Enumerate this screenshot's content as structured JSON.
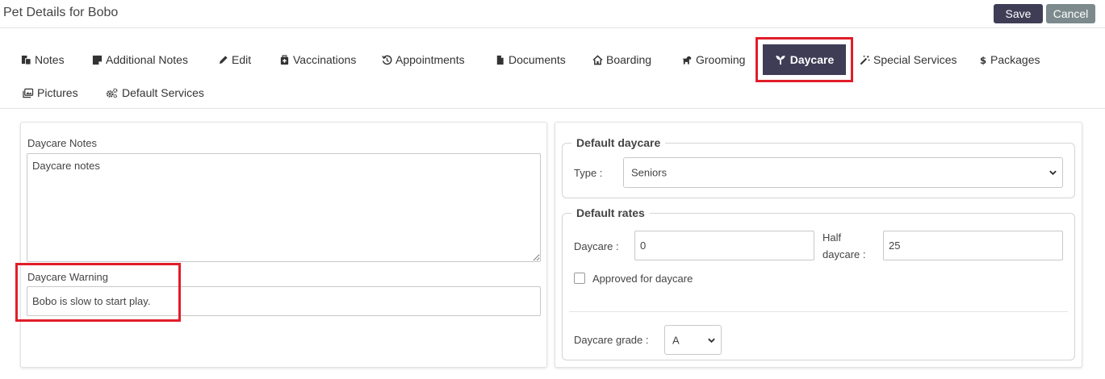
{
  "header": {
    "title": "Pet Details for Bobo",
    "save_label": "Save",
    "cancel_label": "Cancel"
  },
  "tabs": [
    {
      "label": "Notes",
      "icon": "notes-icon"
    },
    {
      "label": "Additional Notes",
      "icon": "sticky-note-icon"
    },
    {
      "label": "Edit",
      "icon": "pencil-icon"
    },
    {
      "label": "Vaccinations",
      "icon": "medkit-icon"
    },
    {
      "label": "Appointments",
      "icon": "history-icon"
    },
    {
      "label": "Documents",
      "icon": "file-icon"
    },
    {
      "label": "Boarding",
      "icon": "home-icon"
    },
    {
      "label": "Grooming",
      "icon": "dog-icon"
    },
    {
      "label": "Daycare",
      "icon": "seedling-icon",
      "active": true
    },
    {
      "label": "Special Services",
      "icon": "magic-wand-icon"
    },
    {
      "label": "Packages",
      "icon": "dollar-icon"
    },
    {
      "label": "Pictures",
      "icon": "images-icon"
    },
    {
      "label": "Default Services",
      "icon": "cogs-icon"
    }
  ],
  "left": {
    "notes_label": "Daycare Notes",
    "notes_value": "Daycare notes",
    "warning_label": "Daycare Warning",
    "warning_value": "Bobo is slow to start play."
  },
  "right": {
    "default_daycare": {
      "legend": "Default daycare",
      "type_label": "Type :",
      "type_value": "Seniors"
    },
    "default_rates": {
      "legend": "Default rates",
      "daycare_label": "Daycare :",
      "daycare_value": "0",
      "half_label_line1": "Half",
      "half_label_line2": "daycare :",
      "half_value": "25",
      "approved_label": "Approved for daycare",
      "approved_checked": false,
      "grade_label": "Daycare grade :",
      "grade_value": "A"
    }
  },
  "colors": {
    "accent": "#3f3d56",
    "cancel": "#7c8a8d",
    "highlight": "#e11d2a"
  }
}
